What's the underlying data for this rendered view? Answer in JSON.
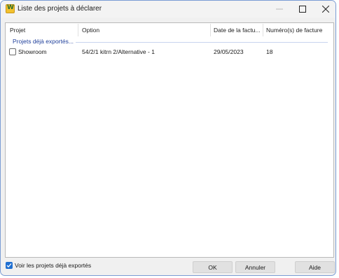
{
  "window": {
    "title": "Liste des projets à déclarer",
    "controls": [
      "minimize",
      "maximize",
      "close"
    ]
  },
  "list": {
    "columns": [
      "Projet",
      "Option",
      "Date de la factu...",
      "Numéro(s) de facture"
    ],
    "group_header": "Projets déjà exportés...",
    "rows": [
      {
        "checked": false,
        "projet": "Showroom",
        "option": "54/2/1 kitrn 2/Alternative - 1",
        "date": "29/05/2023",
        "numero": "18"
      }
    ]
  },
  "footer": {
    "show_exported_label": "Voir les projets déjà exportés",
    "show_exported_checked": true,
    "ok_label": "OK",
    "cancel_label": "Annuler",
    "help_label": "Aide"
  },
  "colors": {
    "accent": "#1f6fd1",
    "group_text": "#1f3f9b"
  }
}
